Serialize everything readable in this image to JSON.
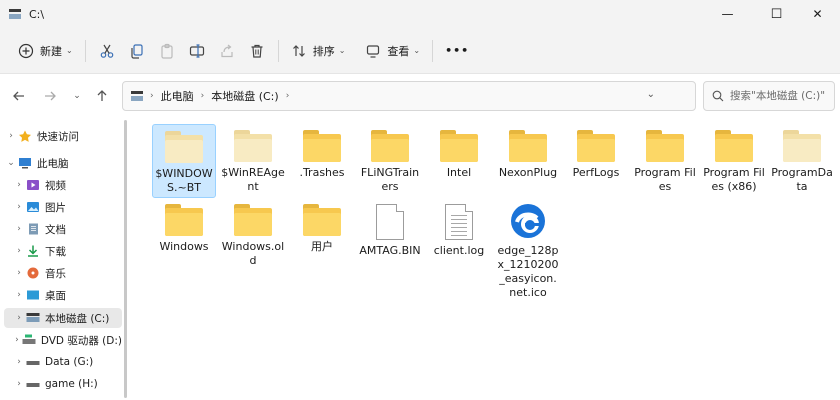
{
  "window": {
    "title": "C:\\",
    "minimize_glyph": "—",
    "maximize_glyph": "☐",
    "close_glyph": "✕"
  },
  "toolbar": {
    "new_label": "新建",
    "sort_label": "排序",
    "view_label": "查看",
    "more_label": "•••"
  },
  "address": {
    "crumbs": [
      "此电脑",
      "本地磁盘 (C:)"
    ]
  },
  "search": {
    "placeholder": "搜索\"本地磁盘 (C:)\""
  },
  "sidebar": {
    "items": [
      {
        "label": "快速访问",
        "icon": "star-icon"
      },
      {
        "label": "此电脑",
        "icon": "computer-icon"
      },
      {
        "label": "视频",
        "icon": "video-icon"
      },
      {
        "label": "图片",
        "icon": "pictures-icon"
      },
      {
        "label": "文档",
        "icon": "documents-icon"
      },
      {
        "label": "下载",
        "icon": "download-icon"
      },
      {
        "label": "音乐",
        "icon": "music-icon"
      },
      {
        "label": "桌面",
        "icon": "desktop-icon"
      },
      {
        "label": "本地磁盘 (C:)",
        "icon": "drive-icon"
      },
      {
        "label": "DVD 驱动器 (D:)",
        "icon": "dvd-icon"
      },
      {
        "label": "Data (G:)",
        "icon": "drive-icon"
      },
      {
        "label": "game (H:)",
        "icon": "drive-icon"
      }
    ]
  },
  "files": [
    {
      "name": "$WINDOWS.~BT",
      "type": "folder-pale"
    },
    {
      "name": "$WinREAgent",
      "type": "folder-pale"
    },
    {
      "name": ".Trashes",
      "type": "folder"
    },
    {
      "name": "FLiNGTrainers",
      "type": "folder"
    },
    {
      "name": "Intel",
      "type": "folder"
    },
    {
      "name": "NexonPlug",
      "type": "folder"
    },
    {
      "name": "PerfLogs",
      "type": "folder"
    },
    {
      "name": "Program Files",
      "type": "folder"
    },
    {
      "name": "Program Files (x86)",
      "type": "folder"
    },
    {
      "name": "ProgramData",
      "type": "folder-pale"
    },
    {
      "name": "Windows",
      "type": "folder"
    },
    {
      "name": "Windows.old",
      "type": "folder"
    },
    {
      "name": "用户",
      "type": "folder"
    },
    {
      "name": "AMTAG.BIN",
      "type": "file"
    },
    {
      "name": "client.log",
      "type": "text-file"
    },
    {
      "name": "edge_128px_1210200_easyicon.net.ico",
      "type": "edge-icon"
    }
  ],
  "colors": {
    "selection": "#cce8ff",
    "folder": "#f7c84f",
    "edge_blue": "#1a73d8"
  }
}
